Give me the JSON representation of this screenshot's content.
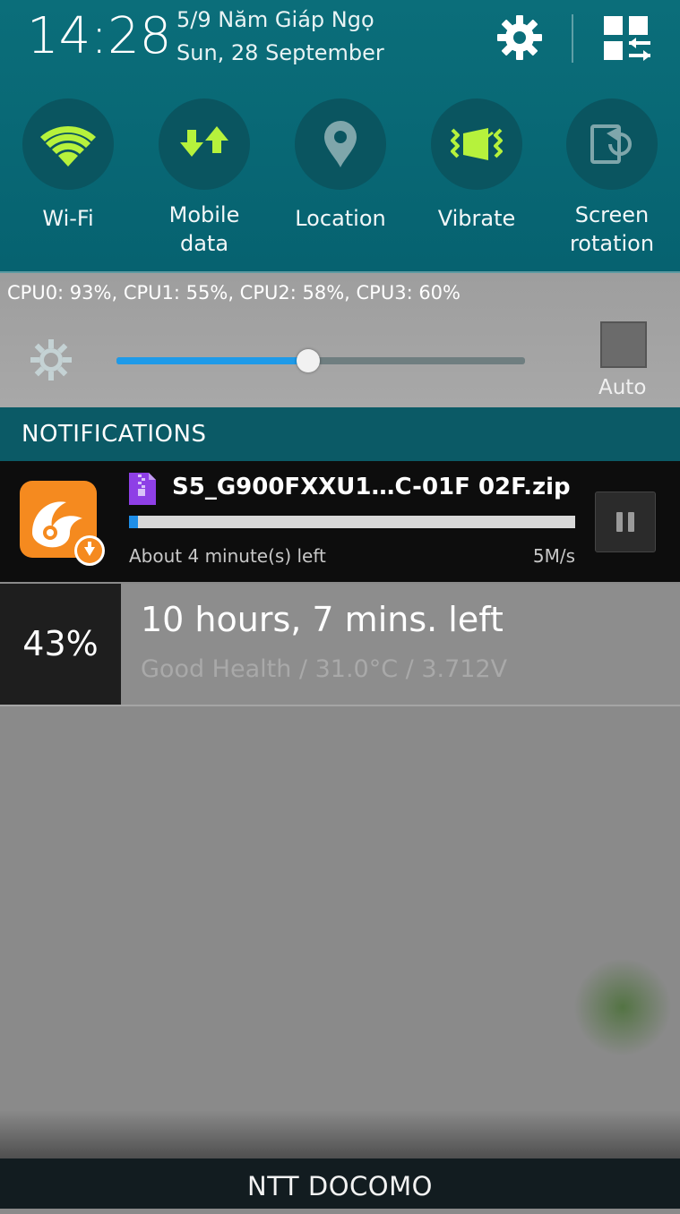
{
  "status": {
    "time": "14:28",
    "lunar_date": "5/9 Năm Giáp Ngọ",
    "date": "Sun, 28 September"
  },
  "quick_settings": [
    {
      "label_line1": "Wi-Fi",
      "label_line2": "",
      "icon": "wifi-icon",
      "active": true
    },
    {
      "label_line1": "Mobile",
      "label_line2": "data",
      "icon": "mobile-data-icon",
      "active": true
    },
    {
      "label_line1": "Location",
      "label_line2": "",
      "icon": "location-icon",
      "active": false
    },
    {
      "label_line1": "Vibrate",
      "label_line2": "",
      "icon": "vibrate-icon",
      "active": true
    },
    {
      "label_line1": "Screen",
      "label_line2": "rotation",
      "icon": "screen-rotation-icon",
      "active": false
    }
  ],
  "cpu": {
    "text": "CPU0: 93%, CPU1: 55%, CPU2: 58%, CPU3: 60%"
  },
  "brightness": {
    "level": 0.47,
    "auto_label": "Auto",
    "auto_checked": false
  },
  "notifications": {
    "header": "NOTIFICATIONS",
    "download": {
      "title": "S5_G900FXXU1…C-01F 02F.zip",
      "progress": 0.02,
      "time_left": "About 4 minute(s) left",
      "speed": "5M/s"
    },
    "battery": {
      "percent": "43%",
      "title": "10 hours, 7 mins. left",
      "subtitle": "Good Health / 31.0°C / 3.712V"
    }
  },
  "carrier": "NTT DOCOMO",
  "colors": {
    "header_bg": "#0b6e7a",
    "active_icon": "#b6f23c",
    "inactive_icon": "#7fa6ab",
    "slider_fill": "#1e9ae8"
  }
}
